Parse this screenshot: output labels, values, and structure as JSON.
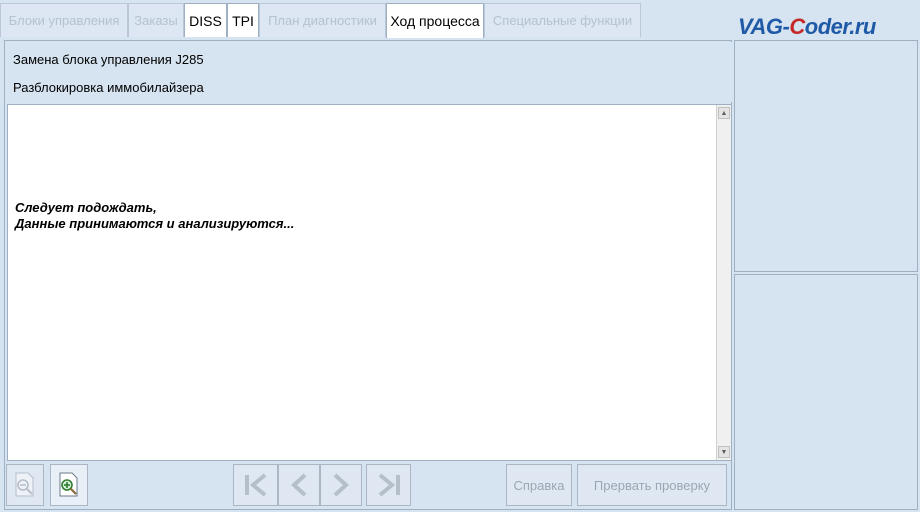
{
  "tabs": [
    {
      "label": "Блоки управления",
      "enabled": false
    },
    {
      "label": "Заказы",
      "enabled": false
    },
    {
      "label": "DISS",
      "enabled": true
    },
    {
      "label": "TPI",
      "enabled": true
    },
    {
      "label": "План диагностики",
      "enabled": false
    },
    {
      "label": "Ход процесса",
      "enabled": true
    },
    {
      "label": "Специальные функции",
      "enabled": false
    }
  ],
  "logo": {
    "part1": "VAG-",
    "part2": "C",
    "part3": "oder.ru"
  },
  "header": {
    "line1": "Замена блока управления J285",
    "line2": "Разблокировка иммобилайзера"
  },
  "content": {
    "message_line1": "Следует подождать,",
    "message_line2": "Данные принимаются и анализируются..."
  },
  "toolbar": {
    "zoom_out_icon": "zoom-out-icon",
    "zoom_in_icon": "zoom-in-icon",
    "first_icon": "first-page-icon",
    "prev_icon": "prev-page-icon",
    "next_icon": "next-page-icon",
    "last_icon": "last-page-icon",
    "help_label": "Справка",
    "abort_label": "Прервать проверку"
  },
  "colors": {
    "background": "#d6e3f1",
    "panel_border": "#9fb0c3",
    "disabled_text": "#b6c2cf"
  }
}
